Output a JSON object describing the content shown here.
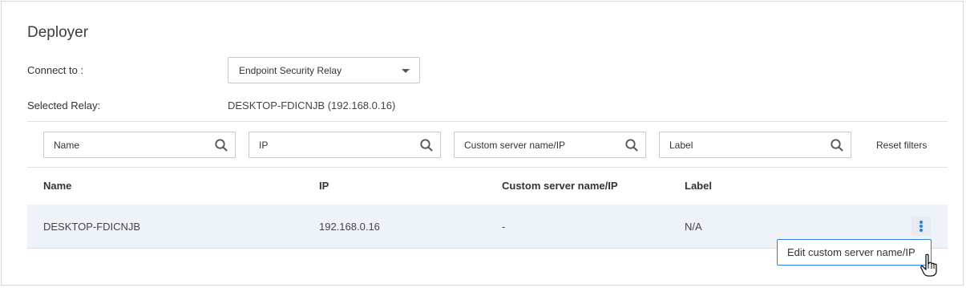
{
  "title": "Deployer",
  "connect": {
    "label": "Connect to :",
    "selected": "Endpoint Security Relay"
  },
  "relay": {
    "label": "Selected Relay:",
    "value": "DESKTOP-FDICNJB (192.168.0.16)"
  },
  "filters": {
    "name_placeholder": "Name",
    "ip_placeholder": "IP",
    "custom_placeholder": "Custom server name/IP",
    "label_placeholder": "Label",
    "reset_label": "Reset filters"
  },
  "table": {
    "columns": [
      "Name",
      "IP",
      "Custom server name/IP",
      "Label"
    ],
    "rows": [
      {
        "name": "DESKTOP-FDICNJB",
        "ip": "192.168.0.16",
        "custom": "-",
        "label": "N/A"
      }
    ]
  },
  "context_menu": {
    "item": "Edit custom server name/IP"
  },
  "colors": {
    "accent": "#2e7fd6",
    "row_selected_bg": "#eef3fa",
    "border": "#c9c9c9"
  },
  "icons": [
    "search-icon",
    "kebab-menu-icon",
    "caret-down-icon",
    "hand-pointer-icon"
  ]
}
